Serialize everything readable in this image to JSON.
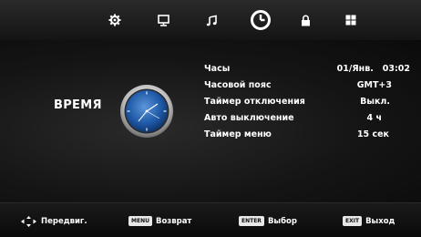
{
  "tabs": [
    {
      "name": "picture-tab",
      "icon": "gear-icon",
      "active": false
    },
    {
      "name": "screen-tab",
      "icon": "monitor-icon",
      "active": false
    },
    {
      "name": "sound-tab",
      "icon": "music-note-icon",
      "active": false
    },
    {
      "name": "time-tab",
      "icon": "clock-icon",
      "active": true
    },
    {
      "name": "lock-tab",
      "icon": "lock-icon",
      "active": false
    },
    {
      "name": "setup-tab",
      "icon": "grid-icon",
      "active": false
    }
  ],
  "page": {
    "title": "ВРЕМЯ",
    "icon": "wall-clock-icon"
  },
  "menu": {
    "items": [
      {
        "label": "Часы",
        "value": "01/Янв.   03:02"
      },
      {
        "label": "Часовой пояс",
        "value": "GMT+3"
      },
      {
        "label": "Таймер отключения",
        "value": "Выкл."
      },
      {
        "label": "Авто выключение",
        "value": "4 ч"
      },
      {
        "label": "Таймер меню",
        "value": "15 сек"
      }
    ]
  },
  "help": {
    "move": {
      "label": "Передвиг.",
      "icon": "dpad-icon"
    },
    "back": {
      "key": "MENU",
      "label": "Возврат"
    },
    "select": {
      "key": "ENTER",
      "label": "Выбор"
    },
    "exit": {
      "key": "EXIT",
      "label": "Выход"
    }
  },
  "colors": {
    "clock_face": "#1f5aa8",
    "clock_rim": "#d8d8d8"
  }
}
